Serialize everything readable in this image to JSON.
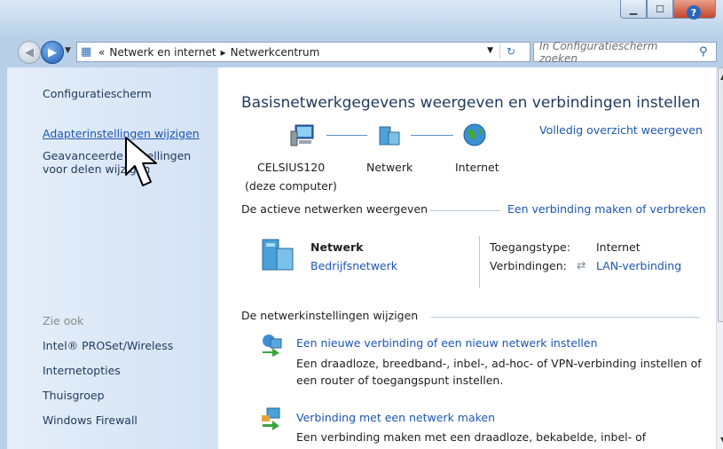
{
  "window": {
    "minimize": "▁",
    "maximize": "☐",
    "close": "✕"
  },
  "nav": {
    "breadcrumb_prefix": "«",
    "crumbs": [
      "Netwerk en internet",
      "Netwerkcentrum"
    ],
    "separator": "▸",
    "search_placeholder": "In Configuratiescherm zoeken"
  },
  "sidebar": {
    "home": "Configuratiescherm",
    "adapter": "Adapterinstellingen wijzigen",
    "advanced_line1": "Geavanceerde instellingen",
    "advanced_line2": "voor delen wijzigen",
    "see_also": "Zie ook",
    "links": [
      "Intel® PROSet/Wireless",
      "Internetopties",
      "Thuisgroep",
      "Windows Firewall"
    ]
  },
  "main": {
    "title": "Basisnetwerkgegevens weergeven en verbindingen instellen",
    "full_map": "Volledig overzicht weergeven",
    "map": {
      "computer": "CELSIUS120",
      "computer_sub": "(deze computer)",
      "network": "Netwerk",
      "internet": "Internet"
    },
    "active_header": "De actieve netwerken weergeven",
    "connect_link": "Een verbinding maken of verbreken",
    "network_name": "Netwerk",
    "network_type": "Bedrijfsnetwerk",
    "access_label": "Toegangstype:",
    "access_value": "Internet",
    "conn_label": "Verbindingen:",
    "conn_value": "LAN-verbinding",
    "settings_header": "De netwerkinstellingen wijzigen",
    "tasks": [
      {
        "title": "Een nieuwe verbinding of een nieuw netwerk instellen",
        "desc1": "Een draadloze, breedband-, inbel-, ad-hoc- of VPN-verbinding instellen of",
        "desc2": "een router of toegangspunt instellen."
      },
      {
        "title": "Verbinding met een netwerk maken",
        "desc1": "Een verbinding maken met een draadloze, bekabelde, inbel- of"
      }
    ]
  }
}
